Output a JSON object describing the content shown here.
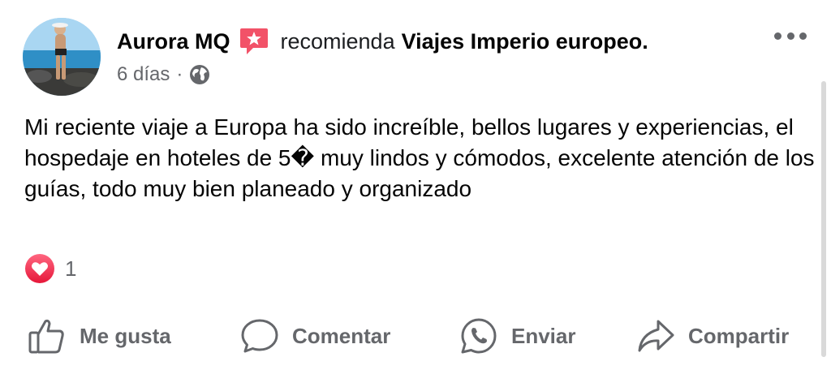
{
  "post": {
    "author": "Aurora MQ",
    "recommends_text": "recomienda",
    "page_name": "Viajes Imperio europeo.",
    "time_ago": "6 días",
    "separator": "·",
    "body": "Mi reciente viaje a Europa ha sido increíble, bellos lugares y experiencias, el hospedaje en hoteles de 5� muy lindos y cómodos, excelente atención de los guías, todo muy bien planeado y organizado",
    "reaction_count": "1"
  },
  "icons": {
    "avatar": "profile-photo",
    "badge": "recommend-star-icon",
    "privacy": "globe-icon",
    "reaction": "love-reaction-icon",
    "more": "more-options-icon"
  },
  "actions": {
    "like_label": "Me gusta",
    "comment_label": "Comentar",
    "send_label": "Enviar",
    "share_label": "Compartir"
  },
  "colors": {
    "badge": "#f25268",
    "love": "#f33e58",
    "secondary_text": "#65676b"
  }
}
